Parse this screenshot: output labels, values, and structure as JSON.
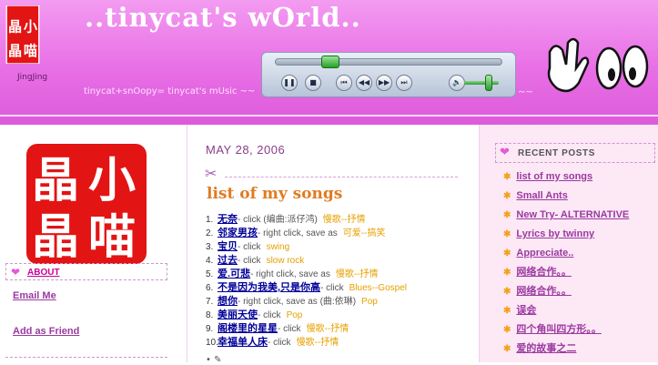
{
  "header": {
    "title": "..tinycat's wOrld..",
    "tagline": "tinycat+snOopy= tinycat's mUsic ~~",
    "tagline_end": "~~",
    "logo_caption": "JingJing"
  },
  "logo_chars": [
    "晶",
    "小",
    "晶",
    "喵"
  ],
  "colors": {
    "header_pink": "#e86fe6",
    "link_purple": "#9a3aa0",
    "title_orange": "#e07b22",
    "genre_gold": "#e6a100"
  },
  "left": {
    "about_label": "ABOUT",
    "email_link": "Email Me",
    "friend_link": "Add as Friend"
  },
  "post": {
    "date": "MAY 28, 2006",
    "title": "list of my songs",
    "songs": [
      {
        "num": "1.",
        "title": "无奈",
        "note": "- click  (编曲:派仔鸿)",
        "genre": "慢歌--抒情"
      },
      {
        "num": "2.",
        "title": "邻家男孩",
        "note": "- right click, save as",
        "genre": "可爱--搞笑"
      },
      {
        "num": "3.",
        "title": "宝贝",
        "note": "- click",
        "genre": "swing"
      },
      {
        "num": "4.",
        "title": "过去",
        "note": "- click",
        "genre": "slow rock"
      },
      {
        "num": "5.",
        "title": "爱.可悲",
        "note": "- right click, save as",
        "genre": "慢歌--抒情"
      },
      {
        "num": "6.",
        "title": "不是因为我美,只是你高",
        "note": "- click",
        "genre": "Blues--Gospel"
      },
      {
        "num": "7.",
        "title": "想你",
        "note": "- right click, save as  (曲:依琳)",
        "genre": "Pop"
      },
      {
        "num": "8.",
        "title": "美丽天使",
        "note": "- click",
        "genre": "Pop"
      },
      {
        "num": "9.",
        "title": "阁楼里的星星",
        "note": "- click",
        "genre": "慢歌--抒情"
      },
      {
        "num": "10.",
        "title": "幸福单人床",
        "note": "- click",
        "genre": "慢歌--抒情"
      }
    ]
  },
  "right": {
    "recent_label": "RECENT POSTS",
    "posts": [
      "list of my songs",
      "Small Ants",
      "New Try- ALTERNATIVE",
      "Lyrics by twinny",
      "Appreciate..",
      "网络合作。。",
      "网络合作。。",
      "误会",
      "四个角叫四方形。。",
      "爱的故事之二"
    ]
  },
  "player": {
    "seek_fraction": 0.22,
    "volume_fraction": 0.75
  }
}
